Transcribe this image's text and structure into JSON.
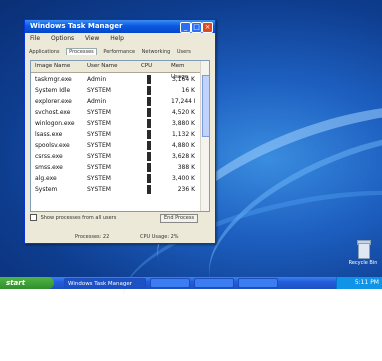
{
  "window": {
    "title": "Windows Task Manager",
    "menu": [
      "File",
      "Options",
      "View",
      "Help"
    ],
    "tabs": [
      "Applications",
      "Processes",
      "Performance",
      "Networking",
      "Users"
    ],
    "columns": [
      "Image Name",
      "User Name",
      "CPU",
      "Mem Usage"
    ],
    "rows": [
      [
        "taskmgr.exe",
        "Admin",
        "00",
        "3,164 K"
      ],
      [
        "System Idle",
        "SYSTEM",
        "98",
        "16 K"
      ],
      [
        "explorer.exe",
        "Admin",
        "00",
        "17,244 K"
      ],
      [
        "svchost.exe",
        "SYSTEM",
        "00",
        "4,520 K"
      ],
      [
        "winlogon.exe",
        "SYSTEM",
        "00",
        "3,880 K"
      ],
      [
        "lsass.exe",
        "SYSTEM",
        "00",
        "1,132 K"
      ],
      [
        "spoolsv.exe",
        "SYSTEM",
        "00",
        "4,880 K"
      ],
      [
        "csrss.exe",
        "SYSTEM",
        "00",
        "3,628 K"
      ],
      [
        "smss.exe",
        "SYSTEM",
        "00",
        "388 K"
      ],
      [
        "alg.exe",
        "SYSTEM",
        "00",
        "3,400 K"
      ],
      [
        "System",
        "SYSTEM",
        "02",
        "236 K"
      ]
    ],
    "show_all_label": "Show processes from all users",
    "end_process_label": "End Process",
    "status_processes": "Processes: 22",
    "status_cpu": "CPU Usage: 2%"
  },
  "desktop": {
    "recycle_label": "Recycle Bin"
  },
  "taskbar": {
    "start_label": "start",
    "tasks": [
      "Windows Task Manager",
      "",
      "",
      ""
    ],
    "clock": "5:11 PM"
  }
}
